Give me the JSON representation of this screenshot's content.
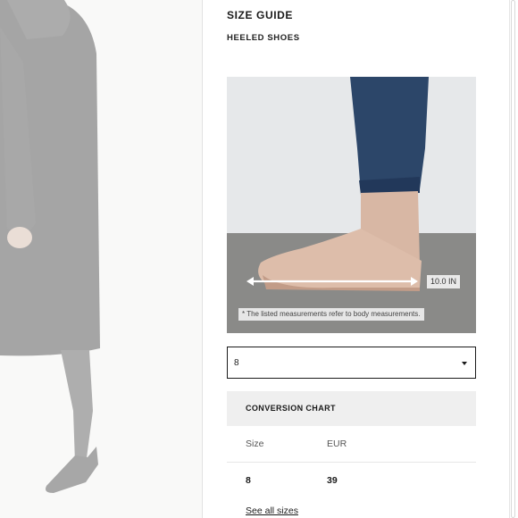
{
  "size_guide": {
    "title": "SIZE GUIDE",
    "subtitle": "HEELED SHOES",
    "measurement_label": "10.0 IN",
    "footnote": "* The listed measurements refer to body measurements.",
    "size_select": {
      "selected": "8"
    }
  },
  "conversion_chart": {
    "title": "CONVERSION CHART",
    "headers": [
      "Size",
      "EUR"
    ],
    "rows": [
      [
        "8",
        "39"
      ]
    ]
  },
  "see_all_link": "See all sizes",
  "icons": {
    "select": "chevron-down-icon",
    "measure": "double-arrow-icon"
  },
  "colors": {
    "background": "#ffffff",
    "header_band": "#efefef",
    "text": "#1a1a1a",
    "select_border": "#1a1a1a"
  }
}
